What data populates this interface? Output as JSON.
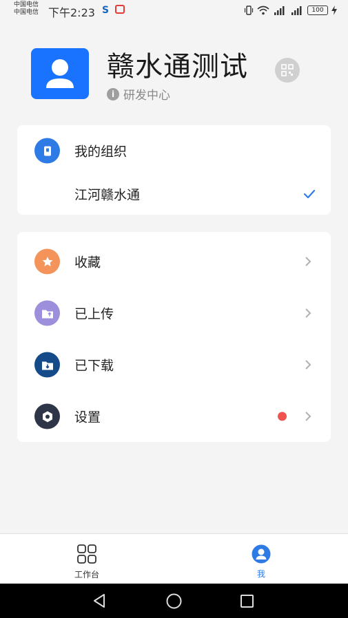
{
  "status_bar": {
    "carrier_line1": "中国电信",
    "carrier_line2": "中国电信",
    "time": "下午2:23",
    "app_icon_1": "S",
    "battery": "100"
  },
  "profile": {
    "name": "赣水通测试",
    "department": "研发中心",
    "info_glyph": "i"
  },
  "org_card": {
    "header_label": "我的组织",
    "selected_org": "江河赣水通"
  },
  "menu": {
    "items": [
      {
        "label": "收藏",
        "color": "#f4935a",
        "icon": "star-icon"
      },
      {
        "label": "已上传",
        "color": "#9d8fdc",
        "icon": "upload-folder-icon"
      },
      {
        "label": "已下载",
        "color": "#164b8a",
        "icon": "download-folder-icon"
      },
      {
        "label": "设置",
        "color": "#2f3548",
        "icon": "settings-icon"
      }
    ]
  },
  "tabbar": {
    "tabs": [
      {
        "label": "工作台",
        "active": false
      },
      {
        "label": "我",
        "active": true
      }
    ]
  },
  "colors": {
    "accent": "#2e7be6",
    "brand_avatar": "#1a73ff",
    "badge_red": "#ef5350"
  }
}
